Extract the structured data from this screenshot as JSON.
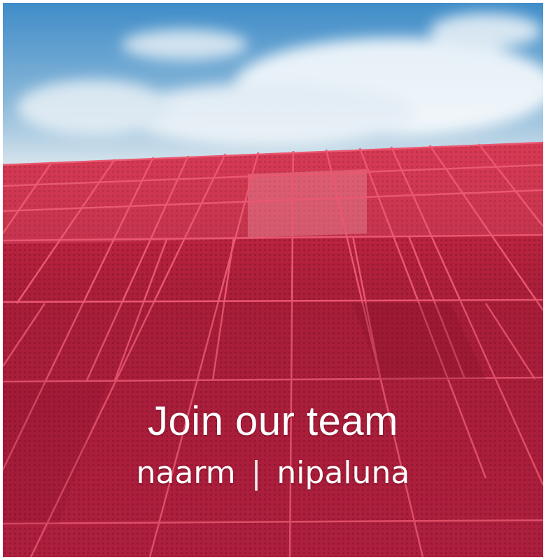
{
  "poster": {
    "headline": "Join our team",
    "place_left": "naarm",
    "place_separator": "|",
    "place_right": "nipaluna"
  },
  "image": {
    "subject": "red-perforated-facade-icon",
    "colors": {
      "sky_top": "#4f97cf",
      "sky_bottom": "#cfe0ea",
      "cloud": "#ffffff",
      "facade": "#b0203c",
      "facade_dark": "#931632",
      "facade_upper": "#d12a45",
      "frame_line": "#e8506a"
    }
  }
}
